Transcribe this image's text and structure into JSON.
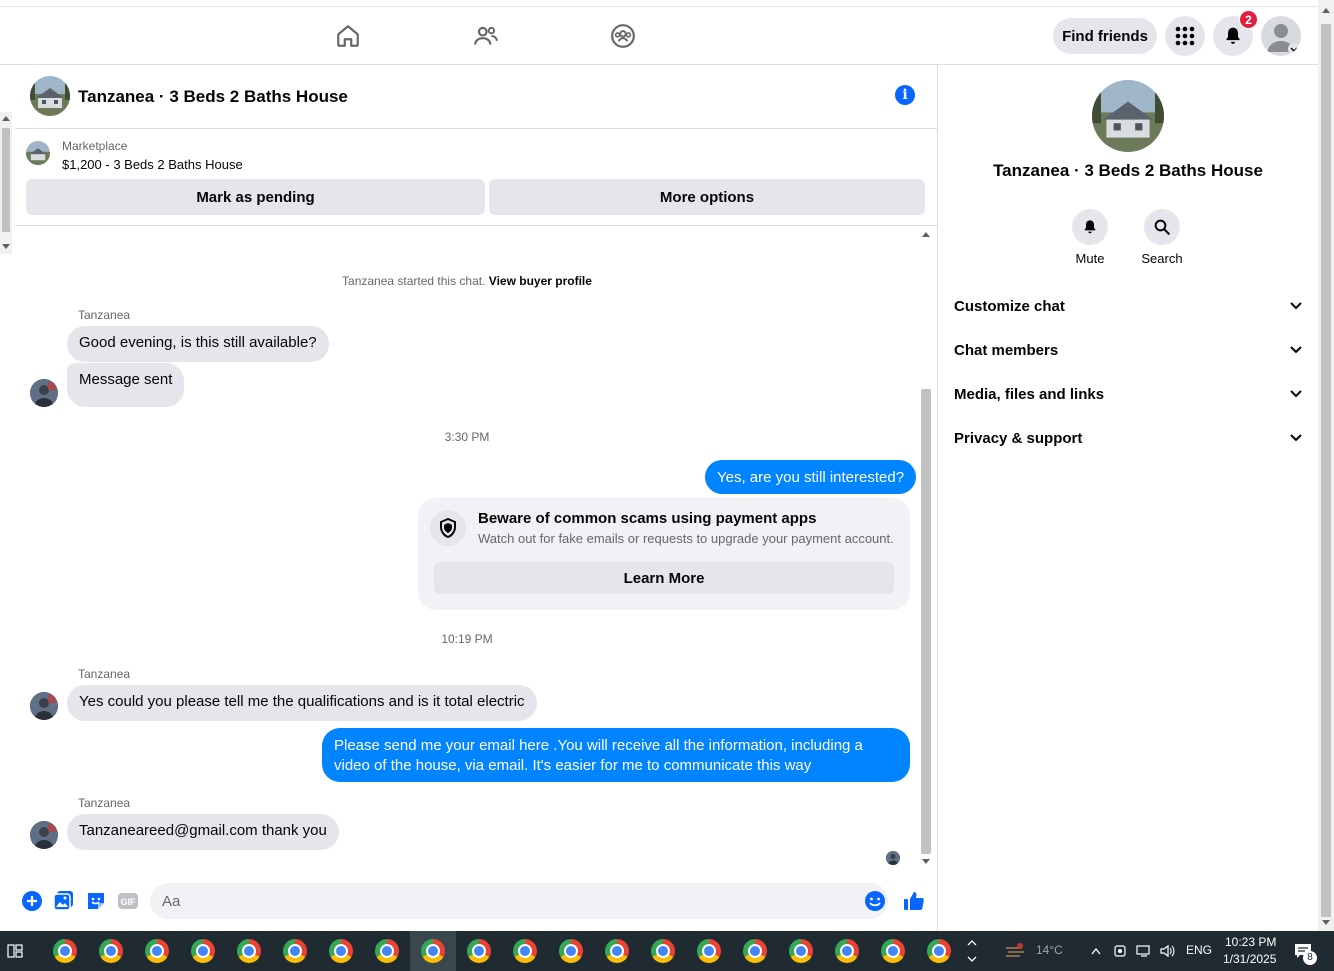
{
  "topbar": {
    "find_friends": "Find friends",
    "notification_count": "2"
  },
  "chat": {
    "title": "Tanzanea · 3 Beds 2 Baths House",
    "marketplace_label": "Marketplace",
    "listing": "$1,200 - 3 Beds 2 Baths House",
    "mark_pending": "Mark as pending",
    "more_options": "More options",
    "started_text": "Tanzanea started this chat.",
    "view_profile": "View buyer profile",
    "messages": {
      "sender": "Tanzanea",
      "m1": "Good evening, is this still available?",
      "m2": "Message sent",
      "time1": "3:30 PM",
      "out1": "Yes, are you still interested?",
      "scam_title": "Beware of common scams using payment apps",
      "scam_sub": "Watch out for fake emails or requests to upgrade your payment account.",
      "learn_more": "Learn More",
      "time2": "10:19 PM",
      "m3": "Yes could you please tell me the qualifications and is it total electric",
      "out2": "Please send me your email here .You will receive all the information, including a video of the house, via email. It's easier for me to communicate this way",
      "m4": "Tanzaneareed@gmail.com thank you"
    },
    "composer_placeholder": "Aa"
  },
  "sidebar": {
    "title": "Tanzanea · 3 Beds 2 Baths House",
    "mute": "Mute",
    "search": "Search",
    "rows": [
      "Customize chat",
      "Chat members",
      "Media, files and links",
      "Privacy & support"
    ]
  },
  "taskbar": {
    "weather": "14°C",
    "lang": "ENG",
    "time": "10:23 PM",
    "date": "1/31/2025",
    "notif": "8"
  },
  "colors": {
    "accent": "#0866ff",
    "bubble_out": "#0084ff",
    "bubble_in": "#e4e6eb"
  }
}
